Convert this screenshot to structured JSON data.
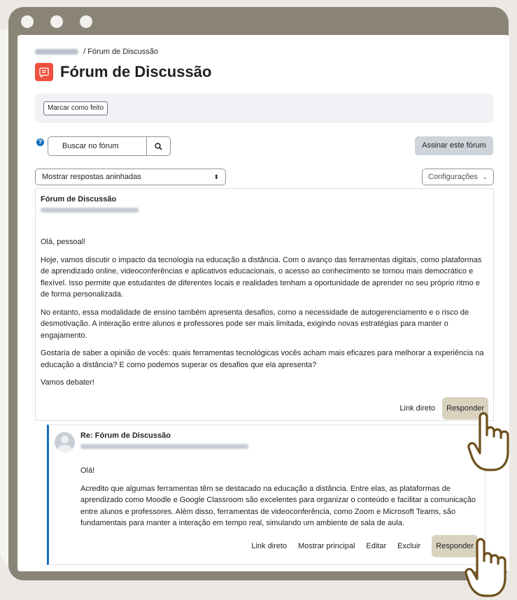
{
  "breadcrumb": {
    "current": "Fórum de Discussão"
  },
  "header": {
    "title": "Fórum de Discussão",
    "icon": "forum-icon"
  },
  "completion": {
    "button_label": "Marcar como feito"
  },
  "search": {
    "placeholder": "Buscar no fórum",
    "button_icon": "search-icon"
  },
  "subscribe": {
    "label": "Assinar este fórum"
  },
  "display_mode": {
    "selected": "Mostrar respostas aninhadas"
  },
  "settings": {
    "label": "Configurações"
  },
  "post": {
    "title": "Fórum de Discussão",
    "paragraphs": [
      "Olá, pessoal!",
      "Hoje, vamos discutir o impacto da tecnologia na educação a distância. Com o avanço das ferramentas digitais, como plataformas de aprendizado online, videoconferências e aplicativos educacionais, o acesso ao conhecimento se tornou mais democrático e flexível. Isso permite que estudantes de diferentes locais e realidades tenham a oportunidade de aprender no seu próprio ritmo e de forma personalizada.",
      "No entanto, essa modalidade de ensino também apresenta desafios, como a necessidade de autogerenciamento e o risco de desmotivação. A interação entre alunos e professores pode ser mais limitada, exigindo novas estratégias para manter o engajamento.",
      "Gostaria de saber a opinião de vocês: quais ferramentas tecnológicas vocês acham mais eficazes para melhorar a experiência na educação a distância? E como podemos superar os desafios que ela apresenta?",
      "Vamos debater!"
    ],
    "actions": {
      "permalink": "Link direto",
      "reply": "Responder"
    }
  },
  "reply": {
    "title": "Re: Fórum de Discussão",
    "paragraphs": [
      "Olá!",
      "Acredito que algumas ferramentas têm se destacado na educação a distância. Entre elas, as plataformas de aprendizado como Moodle e Google Classroom são excelentes para organizar o conteúdo e facilitar a comunicação entre alunos e professores. Além disso, ferramentas de videoconferência, como Zoom e Microsoft Teams, são fundamentais para manter a interação em tempo real, simulando um ambiente de sala de aula."
    ],
    "actions": {
      "permalink": "Link direto",
      "show_parent": "Mostrar principal",
      "edit": "Editar",
      "delete": "Excluir",
      "reply": "Responder"
    }
  },
  "colors": {
    "frame": "#8a8477",
    "accent": "#0f6cbf",
    "forum_icon": "#f0503f",
    "reply_button": "#d9d2bf"
  }
}
